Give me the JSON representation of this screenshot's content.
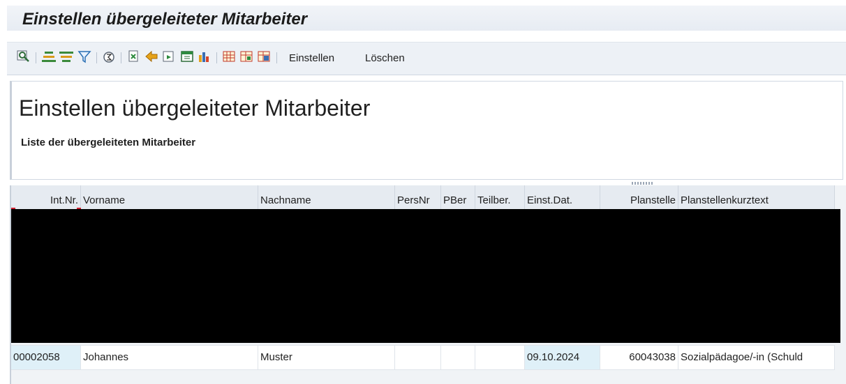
{
  "window": {
    "title": "Einstellen übergeleiteter Mitarbeiter"
  },
  "toolbar": {
    "actions": [
      {
        "icon": "details-magnifier-icon"
      },
      {
        "icon": "sort-ascending-icon"
      },
      {
        "icon": "sort-descending-icon"
      },
      {
        "icon": "filter-icon"
      },
      {
        "icon": "total-sum-icon"
      },
      {
        "icon": "print-preview-icon"
      },
      {
        "icon": "export-icon"
      },
      {
        "icon": "word-processing-icon"
      },
      {
        "icon": "local-file-icon"
      },
      {
        "icon": "abc-analysis-icon"
      },
      {
        "icon": "layout-select-icon"
      },
      {
        "icon": "layout-change-icon"
      },
      {
        "icon": "layout-save-icon"
      }
    ],
    "einstellen_label": "Einstellen",
    "loeschen_label": "Löschen"
  },
  "header": {
    "title": "Einstellen übergeleiteter Mitarbeiter",
    "subtitle": "Liste der übergeleiteten Mitarbeiter"
  },
  "table": {
    "columns": [
      "Int.Nr.",
      "Vorname",
      "Nachname",
      "PersNr",
      "PBer",
      "Teilber.",
      "Einst.Dat.",
      "Planstelle",
      "Planstellenkurztext"
    ],
    "rows": [
      {
        "int_nr": "00002058",
        "vorname": "Johannes",
        "nachname": "Muster",
        "persnr": "",
        "pber": "",
        "teilber": "",
        "einst_dat": "09.10.2024",
        "planstelle": "60043038",
        "planstellenkurztext": "Sozialpädagoe/-in (Schuld"
      }
    ]
  },
  "colors": {
    "key_cell_bg": "#dff0f8",
    "toolbar_bg": "#edf1f6",
    "redaction": "#000000"
  }
}
